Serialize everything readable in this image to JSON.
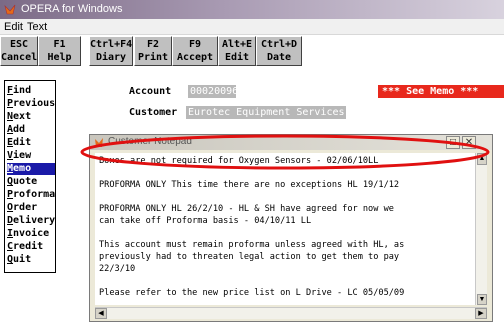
{
  "window": {
    "title": "OPERA for Windows"
  },
  "menubar": {
    "items": [
      "Edit",
      "Text"
    ]
  },
  "toolbar": {
    "keys": [
      {
        "key": "ESC",
        "label": "Cancel"
      },
      {
        "key": "F1",
        "label": "Help"
      },
      {
        "key": "Ctrl+F4",
        "label": "Diary"
      },
      {
        "key": "F2",
        "label": "Print"
      },
      {
        "key": "F9",
        "label": "Accept"
      },
      {
        "key": "Alt+E",
        "label": "Edit"
      },
      {
        "key": "Ctrl+D",
        "label": "Date"
      }
    ]
  },
  "leftmenu": {
    "items": [
      {
        "first": "F",
        "rest": "ind"
      },
      {
        "first": "P",
        "rest": "revious"
      },
      {
        "first": "N",
        "rest": "ext"
      },
      {
        "first": "A",
        "rest": "dd"
      },
      {
        "first": "E",
        "rest": "dit"
      },
      {
        "first": "V",
        "rest": "iew"
      },
      {
        "first": "M",
        "rest": "emo"
      },
      {
        "first": "Q",
        "rest": "uote"
      },
      {
        "first": "P",
        "rest": "roforma"
      },
      {
        "first": "O",
        "rest": "rder"
      },
      {
        "first": "D",
        "rest": "elivery"
      },
      {
        "first": "I",
        "rest": "nvoice"
      },
      {
        "first": "C",
        "rest": "redit"
      },
      {
        "first": "Q",
        "rest": "uit"
      }
    ],
    "active_index": 6
  },
  "account": {
    "label": "Account",
    "value": "00020096"
  },
  "customer": {
    "label": "Customer",
    "value": "Eurotec Equipment Services"
  },
  "memo_flag": "***  See Memo  ***",
  "notepad": {
    "title": "Customer Notepad",
    "lines": [
      "Boxes are not required for Oxygen Sensors - 02/06/10LL",
      "",
      "PROFORMA ONLY This time there are no exceptions HL 19/1/12",
      "",
      "PROFORMA ONLY HL 26/2/10 - HL & SH have agreed for now we",
      "can take off Proforma basis - 04/10/11 LL",
      "",
      "This account must remain proforma unless agreed with HL, as",
      "previously had to threaten legal action to get them to pay",
      "22/3/10",
      "",
      "Please refer to the new price list on L Drive - LC 05/05/09"
    ]
  },
  "colors": {
    "active_menu": "#1a1aa8",
    "memo_flag": "#e8281c",
    "annotation": "#e01010"
  }
}
